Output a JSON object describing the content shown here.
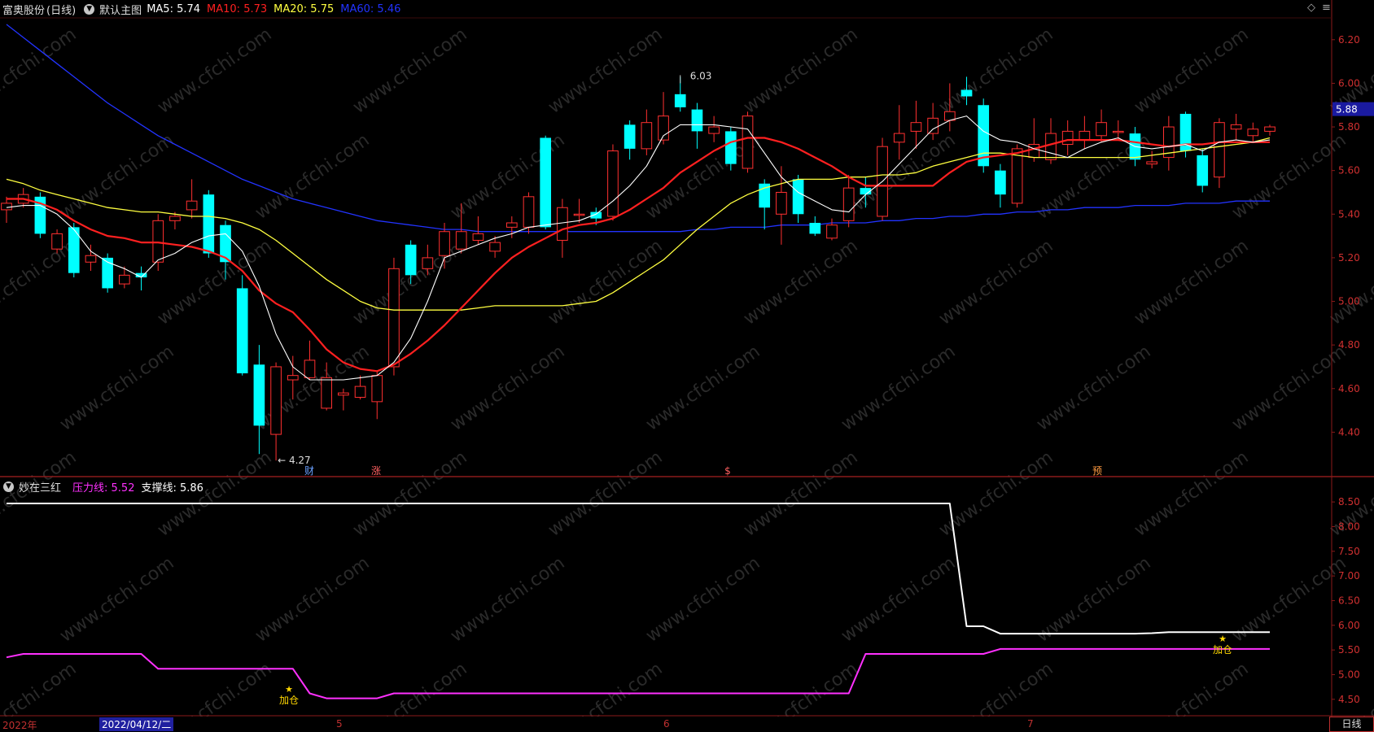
{
  "main_panel": {
    "stock_name": "富奥股份",
    "period": "(日线)",
    "template_label": "默认主图",
    "indicators": [
      {
        "label": "MA5:",
        "value": "5.74",
        "color": "#ffffff"
      },
      {
        "label": "MA10:",
        "value": "5.73",
        "color": "#ff2020"
      },
      {
        "label": "MA20:",
        "value": "5.75",
        "color": "#ffff40"
      },
      {
        "label": "MA60:",
        "value": "5.46",
        "color": "#2233ff"
      }
    ],
    "price_ticks": [
      "6.20",
      "6.00",
      "5.80",
      "5.60",
      "5.40",
      "5.20",
      "5.00",
      "4.80",
      "4.60",
      "4.40"
    ],
    "current_price": "5.88",
    "high_label": "6.03",
    "low_label": "4.27",
    "event_markers": [
      {
        "text": "财",
        "color": "#6aa0ff",
        "x": 380
      },
      {
        "text": "涨",
        "color": "#ff6060",
        "x": 462
      },
      {
        "text": "$",
        "color": "#ff6060",
        "x": 894
      },
      {
        "text": "预",
        "color": "#ff9a40",
        "x": 1348
      }
    ]
  },
  "sub_panel": {
    "name": "妙在三红",
    "indicators": [
      {
        "label": "压力线:",
        "value": "5.52",
        "color": "#ff30ff"
      },
      {
        "label": "支撑线:",
        "value": "5.86",
        "color": "#ffffff"
      }
    ],
    "ticks": [
      "8.50",
      "8.00",
      "7.50",
      "7.00",
      "6.50",
      "6.00",
      "5.50",
      "5.00",
      "4.50"
    ],
    "signals": [
      {
        "text": "加仓",
        "star": "★"
      },
      {
        "text": "加仓",
        "star": "★"
      }
    ]
  },
  "footer": {
    "year_label": "2022年",
    "cursor_date": "2022/04/12/二",
    "months": [
      "5",
      "6",
      "7"
    ],
    "period_tab": "日线"
  },
  "watermark": "www.cfchi.com",
  "chart_data": [
    {
      "type": "candlestick",
      "title": "富奥股份 (日线)",
      "ylim": [
        4.2,
        6.3
      ],
      "series_colors": {
        "up": "#ff3030",
        "down": "#00ffff",
        "MA5": "#ffffff",
        "MA10": "#ff2020",
        "MA20": "#ffff40",
        "MA60": "#2233ff"
      },
      "candles": [
        [
          5.42,
          5.45,
          5.48,
          5.36
        ],
        [
          5.45,
          5.49,
          5.52,
          5.43
        ],
        [
          5.48,
          5.31,
          5.5,
          5.29
        ],
        [
          5.24,
          5.31,
          5.33,
          5.22
        ],
        [
          5.34,
          5.13,
          5.36,
          5.11
        ],
        [
          5.18,
          5.21,
          5.26,
          5.14
        ],
        [
          5.2,
          5.06,
          5.22,
          5.04
        ],
        [
          5.08,
          5.12,
          5.16,
          5.06
        ],
        [
          5.13,
          5.11,
          5.16,
          5.05
        ],
        [
          5.18,
          5.37,
          5.4,
          5.14
        ],
        [
          5.37,
          5.39,
          5.41,
          5.33
        ],
        [
          5.42,
          5.46,
          5.56,
          5.38
        ],
        [
          5.49,
          5.22,
          5.51,
          5.2
        ],
        [
          5.35,
          5.18,
          5.37,
          5.1
        ],
        [
          5.06,
          4.67,
          5.12,
          4.66
        ],
        [
          4.71,
          4.43,
          4.8,
          4.3
        ],
        [
          4.39,
          4.7,
          4.72,
          4.27
        ],
        [
          4.64,
          4.66,
          4.75,
          4.55
        ],
        [
          4.65,
          4.73,
          4.82,
          4.64
        ],
        [
          4.51,
          4.65,
          4.72,
          4.5
        ],
        [
          4.57,
          4.58,
          4.6,
          4.5
        ],
        [
          4.56,
          4.61,
          4.66,
          4.55
        ],
        [
          4.54,
          4.66,
          4.68,
          4.46
        ],
        [
          4.7,
          5.15,
          5.2,
          4.66
        ],
        [
          5.26,
          5.12,
          5.28,
          5.08
        ],
        [
          5.15,
          5.2,
          5.26,
          5.12
        ],
        [
          5.21,
          5.32,
          5.36,
          5.15
        ],
        [
          5.24,
          5.32,
          5.45,
          5.22
        ],
        [
          5.28,
          5.31,
          5.39,
          5.26
        ],
        [
          5.23,
          5.27,
          5.3,
          5.2
        ],
        [
          5.34,
          5.36,
          5.39,
          5.29
        ],
        [
          5.34,
          5.48,
          5.5,
          5.31
        ],
        [
          5.75,
          5.34,
          5.76,
          5.33
        ],
        [
          5.28,
          5.43,
          5.47,
          5.2
        ],
        [
          5.4,
          5.4,
          5.47,
          5.36
        ],
        [
          5.41,
          5.38,
          5.43,
          5.35
        ],
        [
          5.39,
          5.69,
          5.72,
          5.37
        ],
        [
          5.81,
          5.7,
          5.83,
          5.65
        ],
        [
          5.7,
          5.82,
          5.88,
          5.67
        ],
        [
          5.74,
          5.85,
          5.96,
          5.72
        ],
        [
          5.95,
          5.89,
          6.03,
          5.87
        ],
        [
          5.88,
          5.78,
          5.91,
          5.7
        ],
        [
          5.77,
          5.8,
          5.85,
          5.73
        ],
        [
          5.78,
          5.63,
          5.8,
          5.6
        ],
        [
          5.61,
          5.85,
          5.87,
          5.59
        ],
        [
          5.54,
          5.43,
          5.56,
          5.33
        ],
        [
          5.4,
          5.5,
          5.62,
          5.26
        ],
        [
          5.56,
          5.4,
          5.58,
          5.36
        ],
        [
          5.36,
          5.31,
          5.39,
          5.3
        ],
        [
          5.29,
          5.35,
          5.38,
          5.28
        ],
        [
          5.37,
          5.52,
          5.58,
          5.34
        ],
        [
          5.52,
          5.49,
          5.57,
          5.43
        ],
        [
          5.39,
          5.71,
          5.75,
          5.37
        ],
        [
          5.73,
          5.77,
          5.9,
          5.65
        ],
        [
          5.78,
          5.82,
          5.92,
          5.7
        ],
        [
          5.77,
          5.84,
          5.91,
          5.74
        ],
        [
          5.83,
          5.87,
          6.0,
          5.78
        ],
        [
          5.97,
          5.94,
          6.03,
          5.9
        ],
        [
          5.9,
          5.62,
          5.93,
          5.59
        ],
        [
          5.6,
          5.49,
          5.63,
          5.43
        ],
        [
          5.45,
          5.7,
          5.72,
          5.43
        ],
        [
          5.66,
          5.72,
          5.84,
          5.64
        ],
        [
          5.65,
          5.77,
          5.84,
          5.63
        ],
        [
          5.72,
          5.78,
          5.83,
          5.67
        ],
        [
          5.74,
          5.78,
          5.85,
          5.7
        ],
        [
          5.76,
          5.82,
          5.88,
          5.73
        ],
        [
          5.78,
          5.78,
          5.83,
          5.74
        ],
        [
          5.77,
          5.65,
          5.8,
          5.62
        ],
        [
          5.63,
          5.64,
          5.69,
          5.61
        ],
        [
          5.66,
          5.8,
          5.85,
          5.6
        ],
        [
          5.86,
          5.69,
          5.87,
          5.66
        ],
        [
          5.67,
          5.53,
          5.7,
          5.5
        ],
        [
          5.57,
          5.82,
          5.84,
          5.52
        ],
        [
          5.79,
          5.81,
          5.86,
          5.74
        ],
        [
          5.76,
          5.79,
          5.82,
          5.73
        ],
        [
          5.78,
          5.8,
          5.81,
          5.76
        ]
      ],
      "ma": {
        "MA5": [
          5.43,
          5.44,
          5.44,
          5.4,
          5.33,
          5.23,
          5.18,
          5.15,
          5.11,
          5.19,
          5.22,
          5.27,
          5.3,
          5.31,
          5.23,
          5.07,
          4.85,
          4.7,
          4.64,
          4.64,
          4.64,
          4.65,
          4.66,
          4.72,
          4.83,
          5.0,
          5.2,
          5.23,
          5.26,
          5.29,
          5.31,
          5.34,
          5.35,
          5.36,
          5.37,
          5.4,
          5.46,
          5.53,
          5.62,
          5.76,
          5.81,
          5.81,
          5.81,
          5.8,
          5.79,
          5.68,
          5.57,
          5.5,
          5.46,
          5.42,
          5.41,
          5.49,
          5.55,
          5.63,
          5.71,
          5.79,
          5.83,
          5.85,
          5.78,
          5.74,
          5.73,
          5.7,
          5.68,
          5.66,
          5.7,
          5.73,
          5.75,
          5.71,
          5.7,
          5.71,
          5.72,
          5.69,
          5.73,
          5.74,
          5.73,
          5.74
        ],
        "MA10": [
          5.47,
          5.47,
          5.45,
          5.42,
          5.37,
          5.33,
          5.3,
          5.29,
          5.27,
          5.27,
          5.26,
          5.25,
          5.23,
          5.2,
          5.14,
          5.05,
          4.99,
          4.95,
          4.87,
          4.78,
          4.72,
          4.69,
          4.68,
          4.71,
          4.76,
          4.82,
          4.89,
          4.97,
          5.05,
          5.13,
          5.2,
          5.25,
          5.29,
          5.33,
          5.35,
          5.36,
          5.38,
          5.42,
          5.47,
          5.52,
          5.59,
          5.64,
          5.69,
          5.73,
          5.75,
          5.75,
          5.73,
          5.7,
          5.66,
          5.62,
          5.57,
          5.53,
          5.53,
          5.53,
          5.53,
          5.53,
          5.59,
          5.64,
          5.66,
          5.67,
          5.68,
          5.7,
          5.72,
          5.74,
          5.74,
          5.74,
          5.74,
          5.73,
          5.72,
          5.71,
          5.72,
          5.72,
          5.73,
          5.73,
          5.73,
          5.73
        ],
        "MA20": [
          5.56,
          5.54,
          5.51,
          5.49,
          5.47,
          5.45,
          5.43,
          5.42,
          5.41,
          5.41,
          5.4,
          5.39,
          5.39,
          5.38,
          5.36,
          5.33,
          5.28,
          5.22,
          5.16,
          5.1,
          5.05,
          5.0,
          4.97,
          4.96,
          4.96,
          4.96,
          4.96,
          4.96,
          4.97,
          4.98,
          4.98,
          4.98,
          4.98,
          4.98,
          4.99,
          5.0,
          5.04,
          5.09,
          5.14,
          5.19,
          5.26,
          5.33,
          5.39,
          5.45,
          5.49,
          5.52,
          5.54,
          5.56,
          5.56,
          5.56,
          5.57,
          5.57,
          5.58,
          5.58,
          5.59,
          5.62,
          5.64,
          5.66,
          5.68,
          5.68,
          5.67,
          5.66,
          5.66,
          5.66,
          5.66,
          5.66,
          5.66,
          5.66,
          5.67,
          5.68,
          5.69,
          5.7,
          5.71,
          5.72,
          5.73,
          5.75
        ],
        "MA60": [
          6.27,
          6.21,
          6.15,
          6.09,
          6.03,
          5.97,
          5.91,
          5.86,
          5.81,
          5.76,
          5.72,
          5.68,
          5.64,
          5.6,
          5.56,
          5.53,
          5.5,
          5.47,
          5.45,
          5.43,
          5.41,
          5.39,
          5.37,
          5.36,
          5.35,
          5.34,
          5.33,
          5.33,
          5.32,
          5.32,
          5.32,
          5.32,
          5.32,
          5.32,
          5.32,
          5.32,
          5.32,
          5.32,
          5.32,
          5.32,
          5.32,
          5.33,
          5.33,
          5.34,
          5.34,
          5.34,
          5.35,
          5.35,
          5.35,
          5.36,
          5.36,
          5.36,
          5.37,
          5.37,
          5.38,
          5.38,
          5.39,
          5.39,
          5.4,
          5.4,
          5.41,
          5.41,
          5.42,
          5.42,
          5.43,
          5.43,
          5.43,
          5.44,
          5.44,
          5.44,
          5.45,
          5.45,
          5.45,
          5.46,
          5.46,
          5.46
        ]
      }
    },
    {
      "type": "line",
      "title": "妙在三红",
      "ylim": [
        4.2,
        8.7
      ],
      "series": [
        {
          "name": "压力线",
          "color": "#ff30ff",
          "values": [
            5.35,
            5.42,
            5.42,
            5.42,
            5.42,
            5.42,
            5.42,
            5.42,
            5.42,
            5.12,
            5.12,
            5.12,
            5.12,
            5.12,
            5.12,
            5.12,
            5.12,
            5.12,
            4.62,
            4.52,
            4.52,
            4.52,
            4.52,
            4.62,
            4.62,
            4.62,
            4.62,
            4.62,
            4.62,
            4.62,
            4.62,
            4.62,
            4.62,
            4.62,
            4.62,
            4.62,
            4.62,
            4.62,
            4.62,
            4.62,
            4.62,
            4.62,
            4.62,
            4.62,
            4.62,
            4.62,
            4.62,
            4.62,
            4.62,
            4.62,
            4.62,
            5.42,
            5.42,
            5.42,
            5.42,
            5.42,
            5.42,
            5.42,
            5.42,
            5.52,
            5.52,
            5.52,
            5.52,
            5.52,
            5.52,
            5.52,
            5.52,
            5.52,
            5.52,
            5.52,
            5.52,
            5.52,
            5.52,
            5.52,
            5.52,
            5.52
          ]
        },
        {
          "name": "支撑线",
          "color": "#ffffff",
          "values": [
            8.47,
            8.47,
            8.47,
            8.47,
            8.47,
            8.47,
            8.47,
            8.47,
            8.47,
            8.47,
            8.47,
            8.47,
            8.47,
            8.47,
            8.47,
            8.47,
            8.47,
            8.47,
            8.47,
            8.47,
            8.47,
            8.47,
            8.47,
            8.47,
            8.47,
            8.47,
            8.47,
            8.47,
            8.47,
            8.47,
            8.47,
            8.47,
            8.47,
            8.47,
            8.47,
            8.47,
            8.47,
            8.47,
            8.47,
            8.47,
            8.47,
            8.47,
            8.47,
            8.47,
            8.47,
            8.47,
            8.47,
            8.47,
            8.47,
            8.47,
            8.47,
            8.47,
            8.47,
            8.47,
            8.47,
            8.47,
            8.47,
            5.98,
            5.98,
            5.83,
            5.83,
            5.83,
            5.83,
            5.83,
            5.83,
            5.83,
            5.83,
            5.83,
            5.84,
            5.86,
            5.86,
            5.86,
            5.86,
            5.86,
            5.86,
            5.86
          ]
        }
      ]
    }
  ]
}
